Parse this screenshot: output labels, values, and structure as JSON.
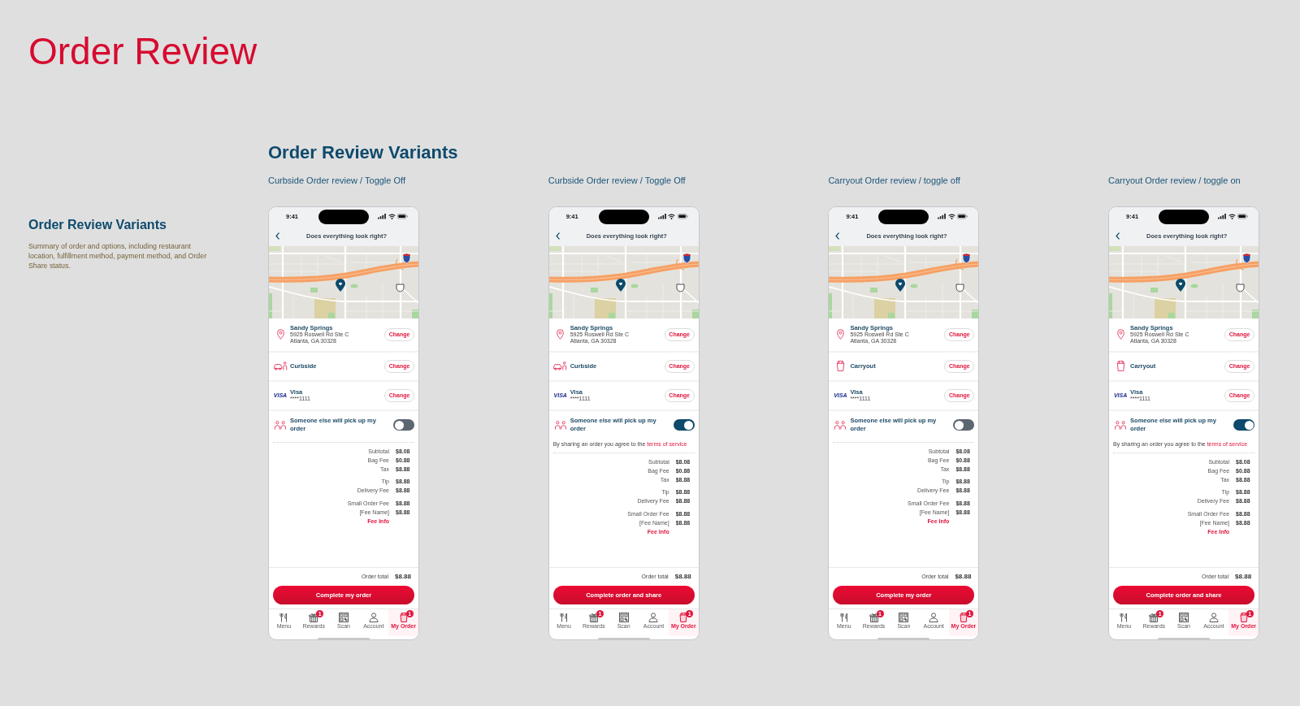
{
  "page": {
    "title": "Order Review"
  },
  "sidebar": {
    "heading": "Order Review Variants",
    "description": "Summary of order and options, including restaurant location, fulfillment method, payment method, and Order Share status."
  },
  "section": {
    "heading": "Order Review Variants"
  },
  "variants": [
    {
      "label": "Curbside Order review / Toggle Off",
      "phone": {
        "time": "9:41",
        "nav_title": "Does everything look right?",
        "location": {
          "name": "Sandy Springs",
          "address": [
            "5925 Roswell Rd Ste C",
            "Atlanta, GA 30328"
          ],
          "action": "Change"
        },
        "fulfillment": {
          "kind": "curbside",
          "label": "Curbside",
          "action": "Change"
        },
        "payment": {
          "brand": "VISA",
          "name": "Visa",
          "number": "****1111",
          "action": "Change"
        },
        "share": {
          "label": "Someone else will pick up my order",
          "on": false
        },
        "fee_groups": [
          {
            "items": [
              {
                "label": "Subtotal",
                "amount": "$8.08"
              },
              {
                "label": "Bag Fee",
                "amount": "$0.88"
              },
              {
                "label": "Tax",
                "amount": "$8.88"
              }
            ]
          },
          {
            "items": [
              {
                "label": "Tip",
                "amount": "$8.88"
              },
              {
                "label": "Delivery Fee",
                "amount": "$8.88"
              }
            ]
          },
          {
            "items": [
              {
                "label": "Small Order Fee",
                "amount": "$8.88"
              },
              {
                "label": "[Fee Name]",
                "amount": "$8.88"
              }
            ]
          }
        ],
        "fee_info": "Fee Info",
        "order_total": {
          "label": "Order total",
          "amount": "$8.88"
        },
        "submit": "Complete my order",
        "tabs": [
          {
            "kind": "menu",
            "label": "Menu",
            "selected": false
          },
          {
            "kind": "rewards",
            "label": "Rewards",
            "badge": "1",
            "selected": false
          },
          {
            "kind": "scan",
            "label": "Scan",
            "selected": false
          },
          {
            "kind": "account",
            "label": "Account",
            "selected": false
          },
          {
            "kind": "order",
            "label": "My Order",
            "badge": "1",
            "selected": true
          }
        ]
      }
    },
    {
      "label": "Curbside Order review / Toggle Off",
      "phone": {
        "time": "9:41",
        "nav_title": "Does everything look right?",
        "location": {
          "name": "Sandy Springs",
          "address": [
            "5925 Roswell Rd Ste C",
            "Atlanta, GA 30328"
          ],
          "action": "Change"
        },
        "fulfillment": {
          "kind": "curbside",
          "label": "Curbside",
          "action": "Change"
        },
        "payment": {
          "brand": "VISA",
          "name": "Visa",
          "number": "****1111",
          "action": "Change"
        },
        "share": {
          "label": "Someone else will pick up my order",
          "on": true,
          "terms": {
            "text": "By sharing an order you agree to the",
            "link": "terms of service"
          }
        },
        "fee_groups": [
          {
            "items": [
              {
                "label": "Subtotal",
                "amount": "$8.08"
              },
              {
                "label": "Bag Fee",
                "amount": "$0.88"
              },
              {
                "label": "Tax",
                "amount": "$8.88"
              }
            ]
          },
          {
            "items": [
              {
                "label": "Tip",
                "amount": "$8.88"
              },
              {
                "label": "Delivery Fee",
                "amount": "$8.88"
              }
            ]
          },
          {
            "items": [
              {
                "label": "Small Order Fee",
                "amount": "$8.88"
              },
              {
                "label": "[Fee Name]",
                "amount": "$8.88"
              }
            ]
          }
        ],
        "fee_info": "Fee Info",
        "order_total": {
          "label": "Order total",
          "amount": "$8.88"
        },
        "submit": "Complete order and share",
        "tabs": [
          {
            "kind": "menu",
            "label": "Menu",
            "selected": false
          },
          {
            "kind": "rewards",
            "label": "Rewards",
            "badge": "1",
            "selected": false
          },
          {
            "kind": "scan",
            "label": "Scan",
            "selected": false
          },
          {
            "kind": "account",
            "label": "Account",
            "selected": false
          },
          {
            "kind": "order",
            "label": "My Order",
            "badge": "1",
            "selected": true
          }
        ]
      }
    },
    {
      "label": "Carryout Order review / toggle off",
      "phone": {
        "time": "9:41",
        "nav_title": "Does everything look right?",
        "location": {
          "name": "Sandy Springs",
          "address": [
            "5925 Roswell Rd Ste C",
            "Atlanta, GA 30328"
          ],
          "action": "Change"
        },
        "fulfillment": {
          "kind": "carryout",
          "label": "Carryout",
          "action": "Change"
        },
        "payment": {
          "brand": "VISA",
          "name": "Visa",
          "number": "****1111",
          "action": "Change"
        },
        "share": {
          "label": "Someone else will pick up my order",
          "on": false
        },
        "fee_groups": [
          {
            "items": [
              {
                "label": "Subtotal",
                "amount": "$8.08"
              },
              {
                "label": "Bag Fee",
                "amount": "$0.88"
              },
              {
                "label": "Tax",
                "amount": "$8.88"
              }
            ]
          },
          {
            "items": [
              {
                "label": "Tip",
                "amount": "$8.88"
              },
              {
                "label": "Delivery Fee",
                "amount": "$8.88"
              }
            ]
          },
          {
            "items": [
              {
                "label": "Small Order Fee",
                "amount": "$8.88"
              },
              {
                "label": "[Fee Name]",
                "amount": "$8.88"
              }
            ]
          }
        ],
        "fee_info": "Fee Info",
        "order_total": {
          "label": "Order total",
          "amount": "$8.88"
        },
        "submit": "Complete my order",
        "tabs": [
          {
            "kind": "menu",
            "label": "Menu",
            "selected": false
          },
          {
            "kind": "rewards",
            "label": "Rewards",
            "badge": "1",
            "selected": false
          },
          {
            "kind": "scan",
            "label": "Scan",
            "selected": false
          },
          {
            "kind": "account",
            "label": "Account",
            "selected": false
          },
          {
            "kind": "order",
            "label": "My Order",
            "badge": "1",
            "selected": true
          }
        ]
      }
    },
    {
      "label": "Carryout Order review / toggle on",
      "phone": {
        "time": "9:41",
        "nav_title": "Does everything look right?",
        "location": {
          "name": "Sandy Springs",
          "address": [
            "5925 Roswell Rd Ste C",
            "Atlanta, GA 30328"
          ],
          "action": "Change"
        },
        "fulfillment": {
          "kind": "carryout",
          "label": "Carryout",
          "action": "Change"
        },
        "payment": {
          "brand": "VISA",
          "name": "Visa",
          "number": "****1111",
          "action": "Change"
        },
        "share": {
          "label": "Someone else will pick up my order",
          "on": true,
          "terms": {
            "text": "By sharing an order you agree to the",
            "link": "terms of service"
          }
        },
        "fee_groups": [
          {
            "items": [
              {
                "label": "Subtotal",
                "amount": "$8.08"
              },
              {
                "label": "Bag Fee",
                "amount": "$0.88"
              },
              {
                "label": "Tax",
                "amount": "$8.88"
              }
            ]
          },
          {
            "items": [
              {
                "label": "Tip",
                "amount": "$8.88"
              },
              {
                "label": "Delivery Fee",
                "amount": "$8.88"
              }
            ]
          },
          {
            "items": [
              {
                "label": "Small Order Fee",
                "amount": "$8.88"
              },
              {
                "label": "[Fee Name]",
                "amount": "$8.88"
              }
            ]
          }
        ],
        "fee_info": "Fee Info",
        "order_total": {
          "label": "Order total",
          "amount": "$8.88"
        },
        "submit": "Complete order and share",
        "tabs": [
          {
            "kind": "menu",
            "label": "Menu",
            "selected": false
          },
          {
            "kind": "rewards",
            "label": "Rewards",
            "badge": "1",
            "selected": false
          },
          {
            "kind": "scan",
            "label": "Scan",
            "selected": false
          },
          {
            "kind": "account",
            "label": "Account",
            "selected": false
          },
          {
            "kind": "order",
            "label": "My Order",
            "badge": "1",
            "selected": true
          }
        ]
      }
    }
  ]
}
